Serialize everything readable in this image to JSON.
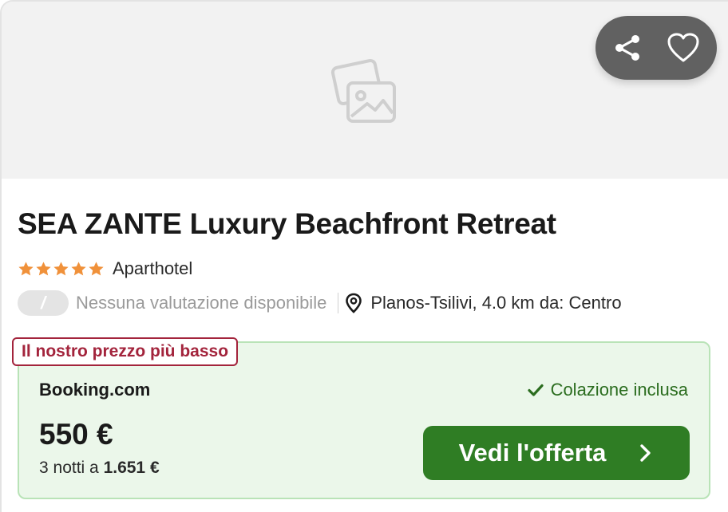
{
  "image": {
    "placeholder_icon": "image-placeholder-icon"
  },
  "actions": {
    "share_icon": "share-icon",
    "favorite_icon": "heart-icon"
  },
  "hotel": {
    "name": "SEA ZANTE Luxury Beachfront Retreat",
    "stars": 5,
    "type": "Aparthotel",
    "rating_badge": "/",
    "rating_text": "Nessuna valutazione disponibile",
    "location": "Planos-Tsilivi, 4.0 km da: Centro"
  },
  "offer": {
    "badge": "Il nostro prezzo più basso",
    "provider": "Booking.com",
    "amenity": "Colazione inclusa",
    "price": "550 €",
    "nights_prefix": "3 notti a ",
    "total": "1.651 €",
    "cta_label": "Vedi l'offerta"
  },
  "colors": {
    "star": "#f0913a",
    "badge_red": "#a3243c",
    "offer_bg": "#ebf7ea",
    "cta_green": "#2f7d24",
    "amenity_green": "#2b6d1f"
  }
}
